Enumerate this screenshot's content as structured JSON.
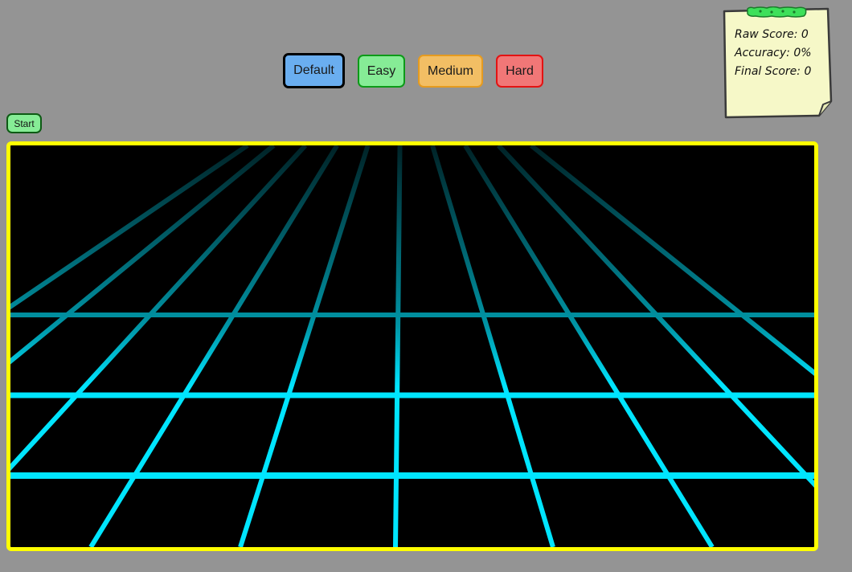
{
  "difficulty": {
    "options": [
      "Default",
      "Easy",
      "Medium",
      "Hard"
    ],
    "selected": "Default"
  },
  "controls": {
    "start_label": "Start"
  },
  "scoreboard": {
    "raw_score_label": "Raw Score:",
    "raw_score": "0",
    "accuracy_label": "Accuracy:",
    "accuracy": "0%",
    "final_score_label": "Final Score:",
    "final_score": "0"
  },
  "colors": {
    "background": "#949494",
    "grid_line": "#00e5ff",
    "frame_border": "#ffff00",
    "note": "#f6f8c8",
    "pin": "#3ee05a"
  }
}
